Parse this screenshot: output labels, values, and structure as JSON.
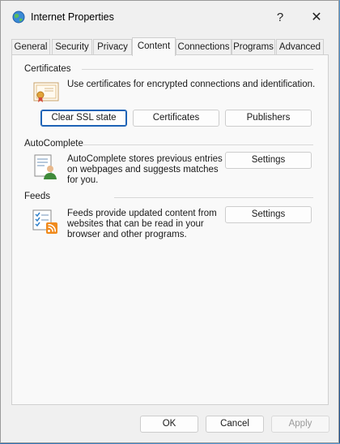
{
  "window": {
    "title": "Internet Properties"
  },
  "titlebar": {
    "help_glyph": "?",
    "close_glyph": "✕"
  },
  "tabs": [
    {
      "label": "General"
    },
    {
      "label": "Security"
    },
    {
      "label": "Privacy"
    },
    {
      "label": "Content",
      "active": true
    },
    {
      "label": "Connections"
    },
    {
      "label": "Programs"
    },
    {
      "label": "Advanced"
    }
  ],
  "certificates": {
    "heading": "Certificates",
    "description": "Use certificates for encrypted connections and identification.",
    "clear_ssl_label": "Clear SSL state",
    "certificates_label": "Certificates",
    "publishers_label": "Publishers"
  },
  "autocomplete": {
    "heading": "AutoComplete",
    "description_lines": [
      "AutoComplete stores previous entries",
      "on webpages and suggests matches",
      "for you."
    ],
    "settings_label": "Settings"
  },
  "feeds": {
    "heading": "Feeds",
    "description_lines": [
      "Feeds provide updated content from",
      "websites that can be read in your",
      "browser and other programs."
    ],
    "settings_label": "Settings"
  },
  "footer": {
    "ok_label": "OK",
    "cancel_label": "Cancel",
    "apply_label": "Apply"
  },
  "colors": {
    "focus_border": "#1e63b6",
    "dialog_bg": "#f0f0f0",
    "panel_bg": "#f9f9f9"
  }
}
